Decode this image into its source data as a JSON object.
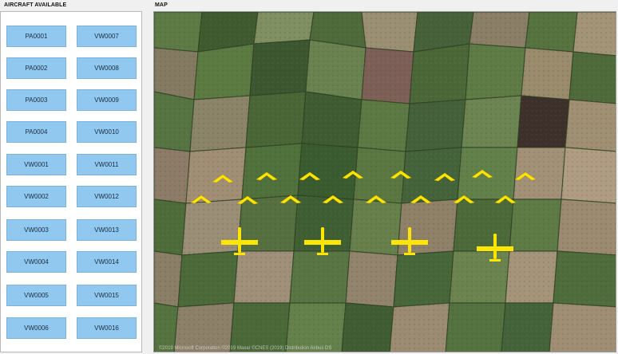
{
  "panels": {
    "aircraft_title": "AIRCRAFT AVAILABLE",
    "map_title": "MAP"
  },
  "aircraft": [
    "PA0001",
    "VW0007",
    "PA0002",
    "VW0008",
    "PA0003",
    "VW0009",
    "PA0004",
    "VW0010",
    "VW0001",
    "VW0011",
    "VW0002",
    "VW0012",
    "VW0003",
    "VW0013",
    "VW0004",
    "VW0014",
    "VW0005",
    "VW0015",
    "VW0006",
    "VW0016"
  ],
  "map": {
    "credit": "©2019 Microsoft Corporation ©2019 Maxar ©CNES (2019) Distribution Airbus DS",
    "colors": {
      "aircraft": "#ffe600",
      "field_dark": "#3e5a2e",
      "field_light": "#8a9a6a"
    },
    "drone_icon": "chevron-drone-icon",
    "plane_icon": "plane-icon"
  }
}
